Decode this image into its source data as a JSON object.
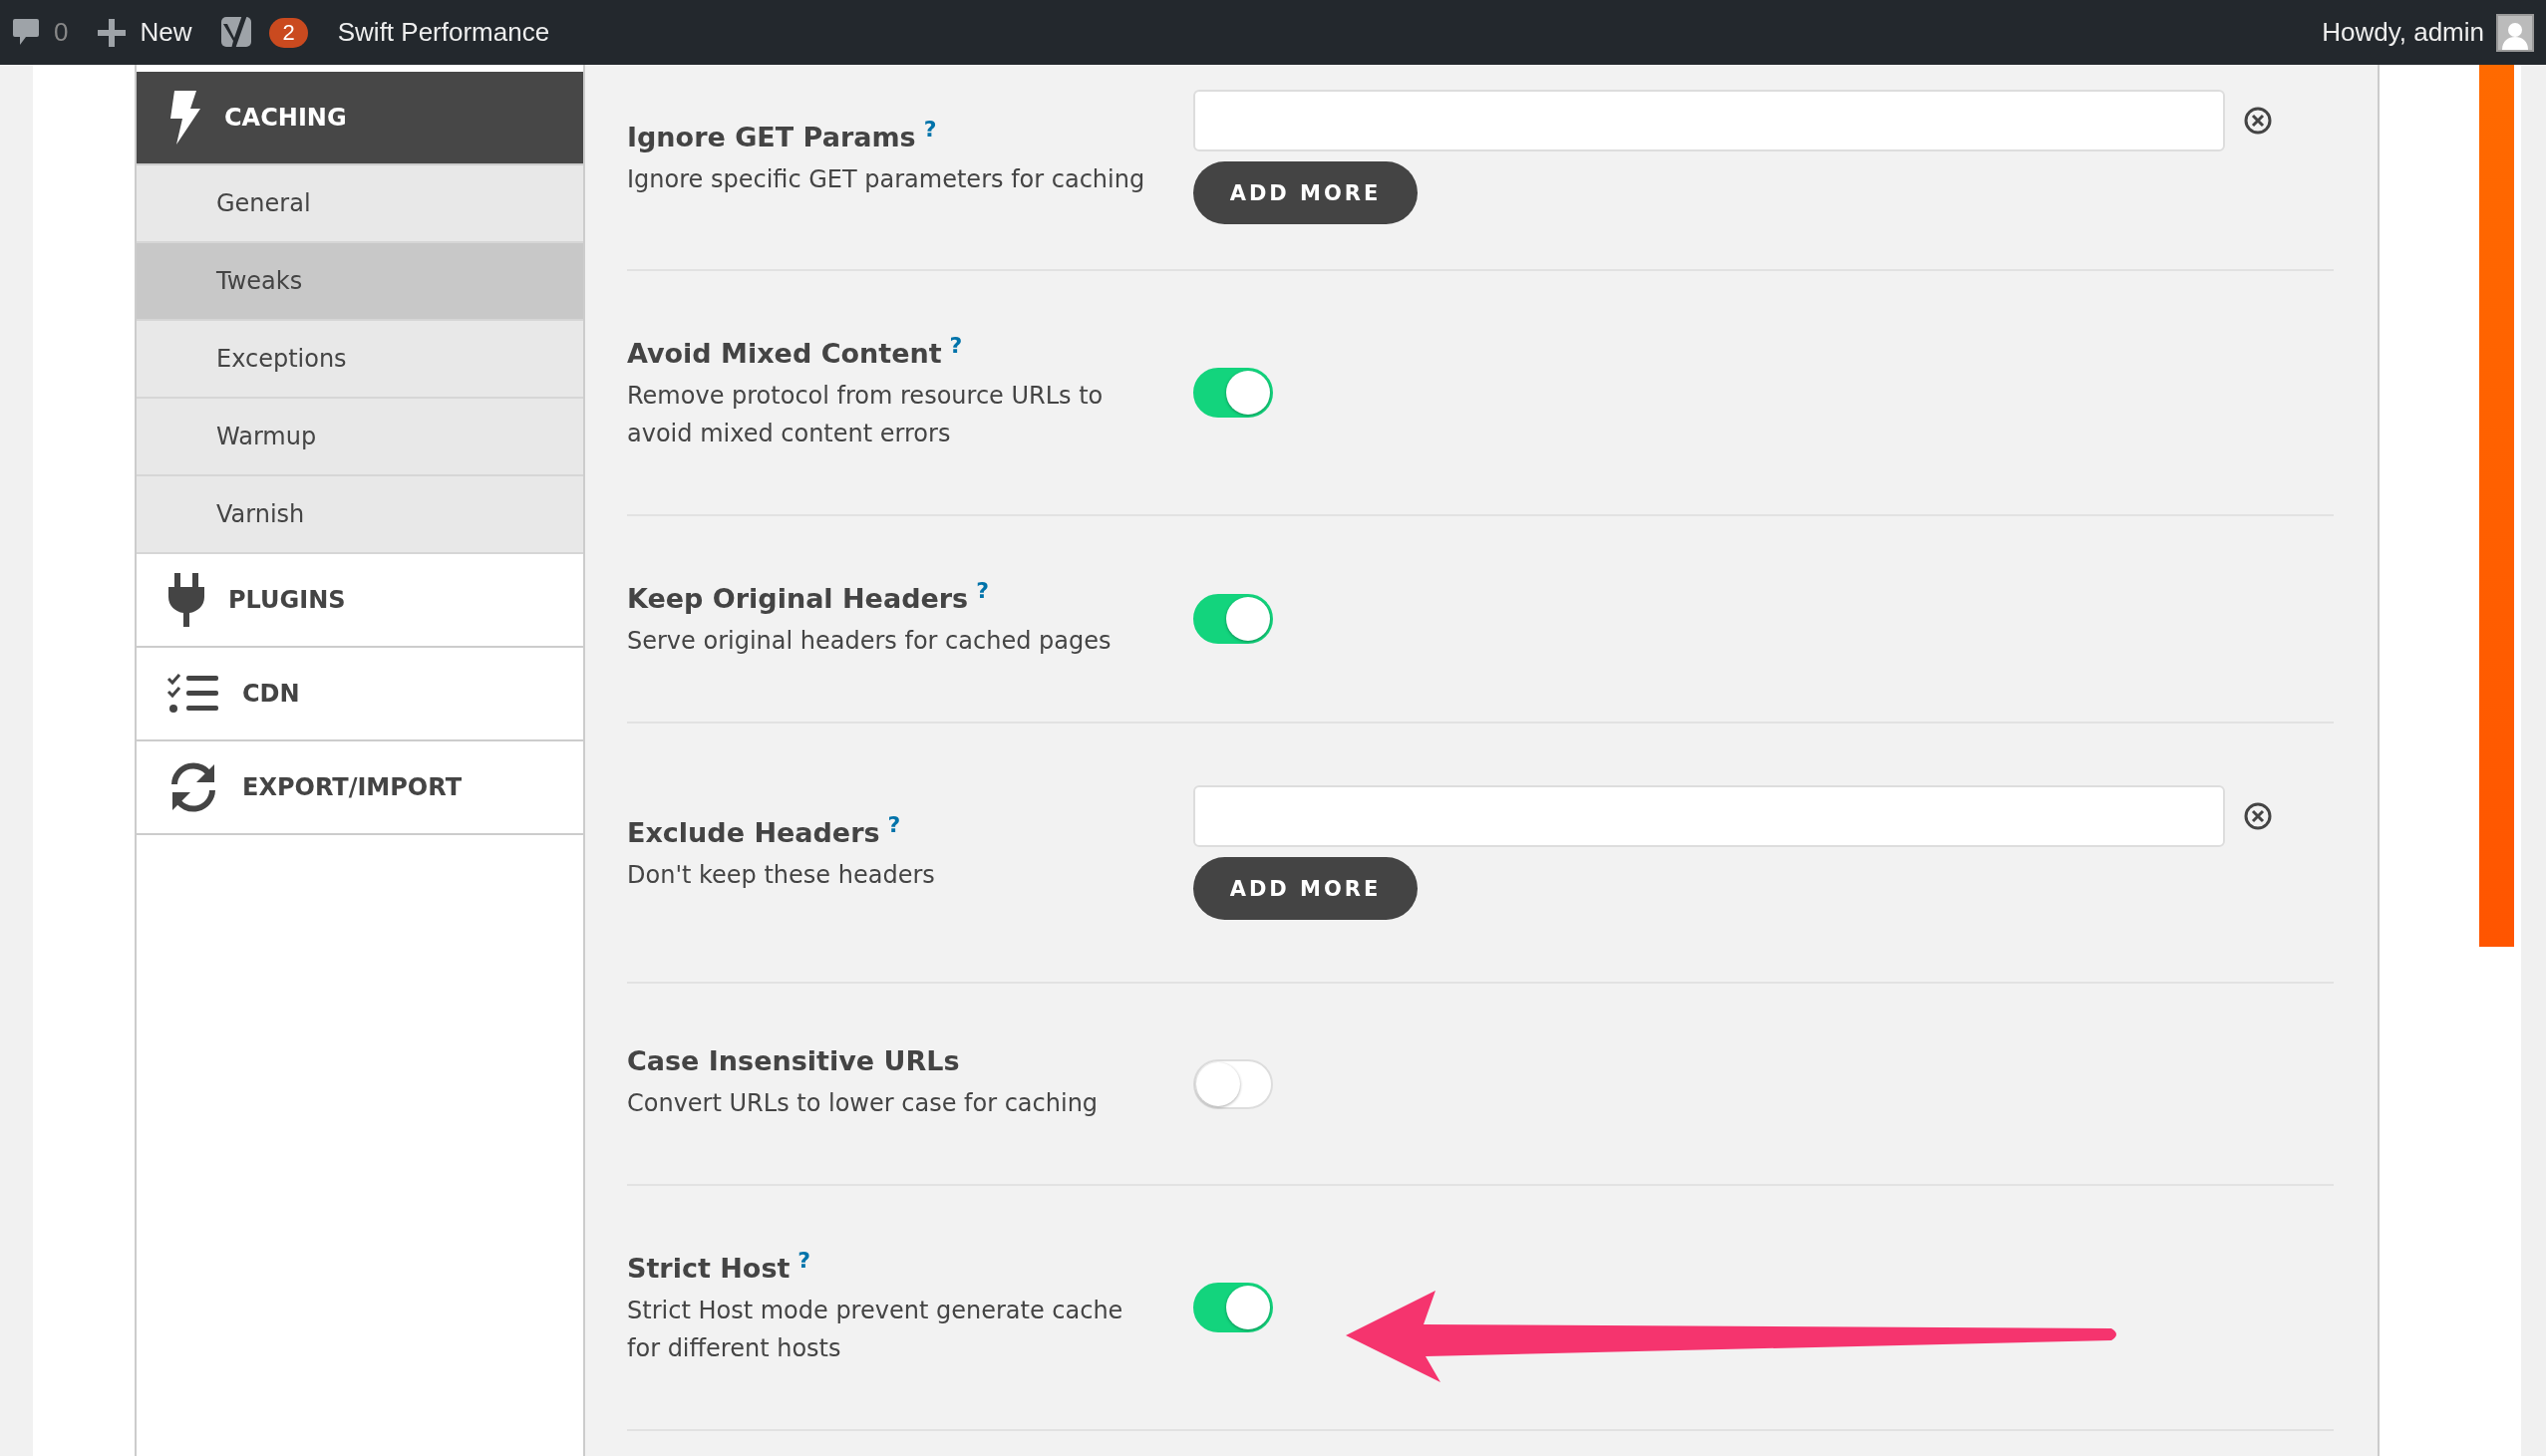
{
  "toolbar": {
    "comments_count": "0",
    "new_label": "New",
    "notifications_badge": "2",
    "site_item": "Swift Performance",
    "greeting": "Howdy, admin"
  },
  "sidebar": {
    "items": [
      {
        "label": "CACHING",
        "selected": true,
        "children": [
          {
            "label": "General",
            "selected": false
          },
          {
            "label": "Tweaks",
            "selected": true
          },
          {
            "label": "Exceptions",
            "selected": false
          },
          {
            "label": "Warmup",
            "selected": false
          },
          {
            "label": "Varnish",
            "selected": false
          }
        ]
      },
      {
        "label": "PLUGINS",
        "selected": false
      },
      {
        "label": "CDN",
        "selected": false
      },
      {
        "label": "EXPORT/IMPORT",
        "selected": false
      }
    ]
  },
  "settings": [
    {
      "kind": "list",
      "label": "Ignore GET Params",
      "help": "?",
      "description": "Ignore specific GET parameters for caching",
      "add_button": "ADD MORE"
    },
    {
      "kind": "toggle",
      "label": "Avoid Mixed Content",
      "help": "?",
      "description": "Remove protocol from resource URLs to avoid mixed content errors",
      "on": true
    },
    {
      "kind": "toggle",
      "label": "Keep Original Headers",
      "help": "?",
      "description": "Serve original headers for cached pages",
      "on": true
    },
    {
      "kind": "list",
      "label": "Exclude Headers",
      "help": "?",
      "description": "Don't keep these headers",
      "add_button": "ADD MORE"
    },
    {
      "kind": "toggle",
      "label": "Case Insensitive URLs",
      "description": "Convert URLs to lower case for caching",
      "on": false
    },
    {
      "kind": "toggle",
      "label": "Strict Host",
      "help": "?",
      "description": "Strict Host mode prevent generate cache for different hosts",
      "on": true
    }
  ]
}
